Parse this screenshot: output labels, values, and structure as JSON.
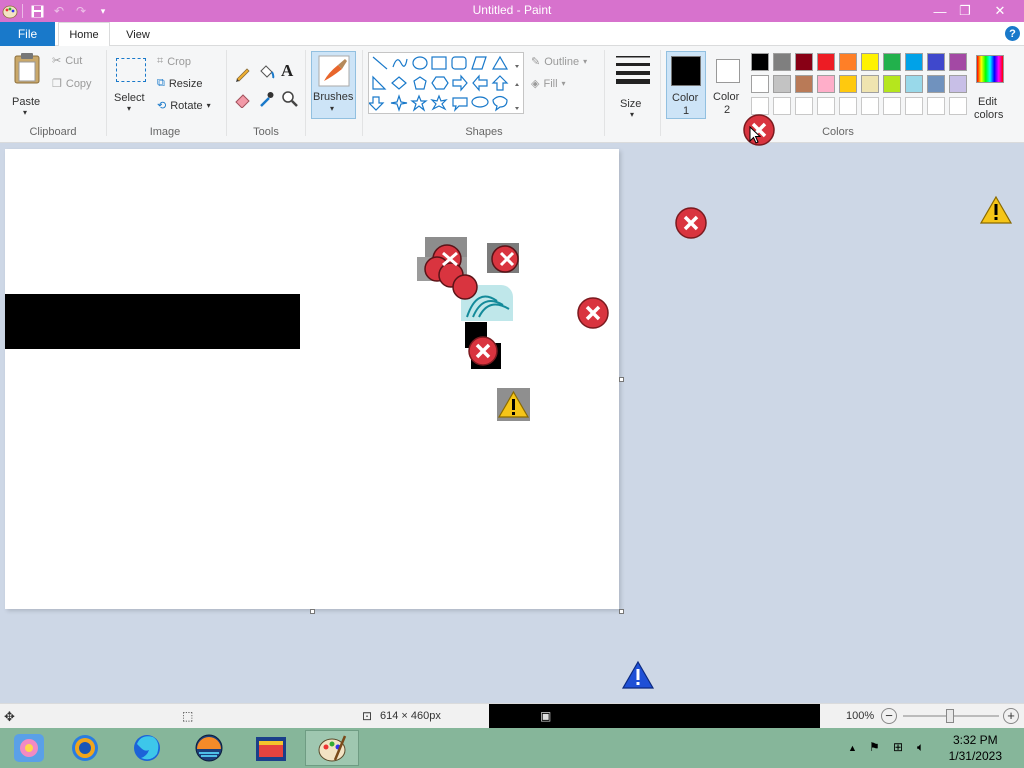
{
  "window": {
    "title": "Untitled - Paint"
  },
  "tabs": {
    "file": "File",
    "home": "Home",
    "view": "View"
  },
  "ribbon": {
    "clipboard": {
      "label": "Clipboard",
      "paste": "Paste",
      "cut": "Cut",
      "copy": "Copy"
    },
    "image": {
      "label": "Image",
      "select": "Select",
      "crop": "Crop",
      "resize": "Resize",
      "rotate": "Rotate"
    },
    "tools": {
      "label": "Tools"
    },
    "brushes": {
      "label": "Brushes"
    },
    "shapes": {
      "label": "Shapes",
      "outline": "Outline",
      "fill": "Fill"
    },
    "size": {
      "label": "Size"
    },
    "colors": {
      "label": "Colors",
      "color1": "Color",
      "color1_num": "1",
      "color2": "Color",
      "color2_num": "2",
      "edit": "Edit",
      "edit2": "colors",
      "primary": "#000000",
      "secondary": "#ffffff",
      "palette_row1": [
        "#000000",
        "#7f7f7f",
        "#880015",
        "#ed1c24",
        "#ff7f27",
        "#fff200",
        "#22b14c",
        "#00a2e8",
        "#3f48cc",
        "#a349a4"
      ],
      "palette_row2": [
        "#ffffff",
        "#c3c3c3",
        "#b97a57",
        "#ffaec9",
        "#ffc90e",
        "#efe4b0",
        "#b5e61d",
        "#99d9ea",
        "#7092be",
        "#c8bfe7"
      ]
    }
  },
  "statusbar": {
    "canvas_size": "614 × 460px",
    "zoom": "100%"
  },
  "taskbar": {
    "time": "3:32 PM",
    "date": "1/31/2023"
  },
  "colors": {
    "titlebar": "#d772cd",
    "file_tab": "#1979ca",
    "workspace": "#cdd7e6",
    "taskbar": "#86b69a"
  }
}
